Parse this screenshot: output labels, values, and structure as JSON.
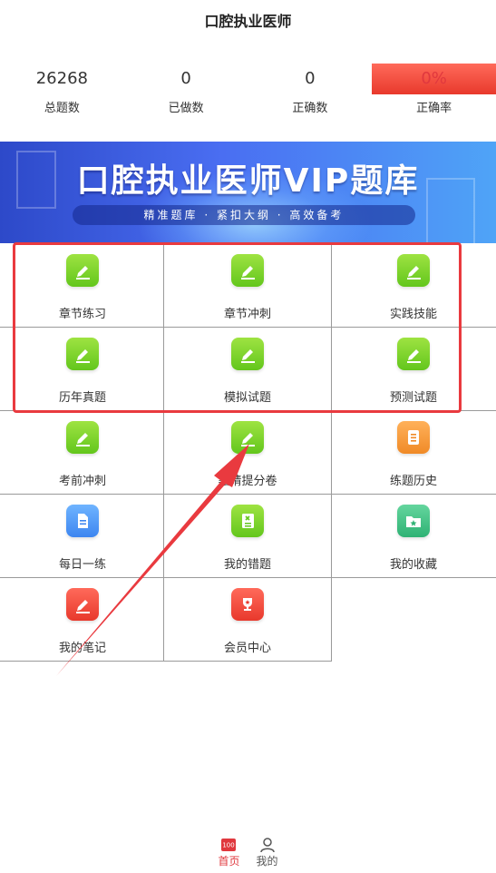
{
  "header": {
    "title": "口腔执业医师"
  },
  "stats": [
    {
      "value": "26268",
      "label": "总题数"
    },
    {
      "value": "0",
      "label": "已做数"
    },
    {
      "value": "0",
      "label": "正确数"
    },
    {
      "value": "0%",
      "label": "正确率"
    }
  ],
  "banner": {
    "title": "口腔执业医师VIP题库",
    "subtitle": "精准题库 · 紧扣大纲 · 高效备考"
  },
  "grid": [
    {
      "label": "章节练习",
      "icon": "pencil-icon",
      "color": "#7cd42d"
    },
    {
      "label": "章节冲刺",
      "icon": "pencil-icon",
      "color": "#7cd42d"
    },
    {
      "label": "实践技能",
      "icon": "pencil-icon",
      "color": "#7cd42d"
    },
    {
      "label": "历年真题",
      "icon": "pencil-icon",
      "color": "#7cd42d"
    },
    {
      "label": "模拟试题",
      "icon": "pencil-icon",
      "color": "#7cd42d"
    },
    {
      "label": "预测试题",
      "icon": "pencil-icon",
      "color": "#7cd42d"
    },
    {
      "label": "考前冲刺",
      "icon": "pencil-icon",
      "color": "#7cd42d"
    },
    {
      "label": "點睛提分卷",
      "icon": "pencil-icon",
      "color": "#7cd42d"
    },
    {
      "label": "练题历史",
      "icon": "document-list-icon",
      "color": "#f59a36"
    },
    {
      "label": "每日一练",
      "icon": "document-icon",
      "color": "#4a94f6"
    },
    {
      "label": "我的错题",
      "icon": "wrong-book-icon",
      "color": "#7cd42d"
    },
    {
      "label": "我的收藏",
      "icon": "star-folder-icon",
      "color": "#3cc083"
    },
    {
      "label": "我的笔记",
      "icon": "note-pencil-icon",
      "color": "#f04a3a"
    },
    {
      "label": "会员中心",
      "icon": "trophy-icon",
      "color": "#f04a3a"
    }
  ],
  "tabbar": {
    "home_label": "首页",
    "home_badge": "100",
    "mine_label": "我的"
  },
  "colors": {
    "accent": "#e0383e",
    "highlight": "#e93a3f"
  }
}
